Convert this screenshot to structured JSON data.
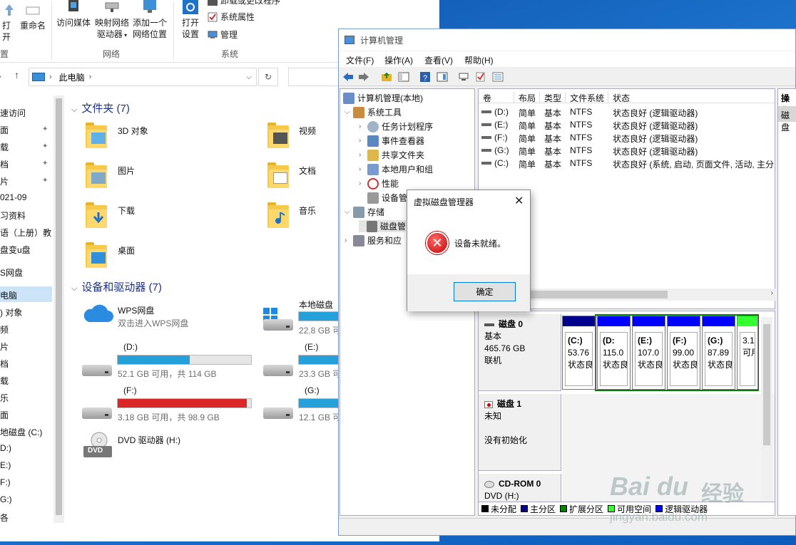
{
  "explorer": {
    "ribbon": {
      "open_partial": "打开",
      "rename": "重命名",
      "left_group_partial": "置",
      "access_media": "访问媒体",
      "map_drive_line1": "映射网络",
      "map_drive_line2": "驱动器",
      "add_location_line1": "添加一个",
      "add_location_line2": "网络位置",
      "group_network": "网络",
      "open_settings_line1": "打开",
      "open_settings_line2": "设置",
      "uninstall_partial": "卸载或更改程序",
      "system_props": "系统属性",
      "manage": "管理",
      "group_system": "系统"
    },
    "address": {
      "path": "此电脑"
    },
    "nav": {
      "items": [
        "速访问",
        "面",
        "载",
        "档",
        "片",
        "021-09",
        "习资料",
        "语（上册）教",
        "盘变u盘",
        "S网盘",
        "电脑",
        ") 对象",
        "频",
        "片",
        "档",
        "载",
        "乐",
        "面",
        "地磁盘 (C:)",
        "D:)",
        "E:)",
        "F:)",
        "G:)",
        "各"
      ]
    },
    "folders_section": {
      "title": "文件夹 (7)"
    },
    "folders": [
      "3D 对象",
      "视频",
      "图片",
      "文档",
      "下载",
      "音乐",
      "桌面"
    ],
    "devices_section": {
      "title": "设备和驱动器 (7)"
    },
    "devices": {
      "wps_name": "WPS网盘",
      "wps_desc": "双击进入WPS网盘",
      "c_name": "本地磁盘",
      "c_free": "22.8 GB 可",
      "d_name": "(D:)",
      "d_free": "52.1 GB 可用，共 114 GB",
      "d_used": 0.54,
      "e_name": "(E:)",
      "e_free": "23.3 GB 可",
      "f_name": "(F:)",
      "f_free": "3.18 GB 可用，共 98.9 GB",
      "f_used": 0.97,
      "g_name": "(G:)",
      "g_free": "12.1 GB 可",
      "dvd_name": "DVD 驱动器 (H:)",
      "dvd_label": "DVD"
    }
  },
  "cm": {
    "title": "计算机管理",
    "menu": [
      "文件(F)",
      "操作(A)",
      "查看(V)",
      "帮助(H)"
    ],
    "tree": {
      "root": "计算机管理(本地)",
      "system_tools": "系统工具",
      "task_scheduler": "任务计划程序",
      "event_viewer": "事件查看器",
      "shared_folders": "共享文件夹",
      "local_users": "本地用户和组",
      "performance": "性能",
      "device_mgr": "设备管",
      "storage": "存储",
      "disk_mgmt": "磁盘管",
      "services": "服务和应"
    },
    "volume_headers": [
      "卷",
      "布局",
      "类型",
      "文件系统",
      "状态"
    ],
    "volumes": [
      {
        "vol": "(D:)",
        "layout": "简单",
        "type": "基本",
        "fs": "NTFS",
        "status": "状态良好 (逻辑驱动器)"
      },
      {
        "vol": "(E:)",
        "layout": "简单",
        "type": "基本",
        "fs": "NTFS",
        "status": "状态良好 (逻辑驱动器)"
      },
      {
        "vol": "(F:)",
        "layout": "简单",
        "type": "基本",
        "fs": "NTFS",
        "status": "状态良好 (逻辑驱动器)"
      },
      {
        "vol": "(G:)",
        "layout": "简单",
        "type": "基本",
        "fs": "NTFS",
        "status": "状态良好 (逻辑驱动器)"
      },
      {
        "vol": "(C:)",
        "layout": "简单",
        "type": "基本",
        "fs": "NTFS",
        "status": "状态良好 (系统, 启动, 页面文件, 活动, 主分"
      }
    ],
    "actions": {
      "header": "操作",
      "sub": "磁盘"
    },
    "disk0": {
      "name": "磁盘 0",
      "type": "基本",
      "size": "465.76 GB",
      "state": "联机"
    },
    "disk0_parts": [
      {
        "label": "(C:)",
        "size": "53.76",
        "status": "状态良"
      },
      {
        "label": "(D:",
        "size": "115.0",
        "status": "状态良"
      },
      {
        "label": "(E:)",
        "size": "107.0",
        "status": "状态良"
      },
      {
        "label": "(F:)",
        "size": "99.00",
        "status": "状态良"
      },
      {
        "label": "(G:)",
        "size": "87.89",
        "status": "状态良"
      },
      {
        "label": "",
        "size": "3.1",
        "status": "可用"
      }
    ],
    "disk1": {
      "name": "磁盘 1",
      "state": "未知",
      "note": "没有初始化"
    },
    "cdrom": {
      "name": "CD-ROM 0",
      "drive": "DVD (H:)"
    },
    "legend": [
      "未分配",
      "主分区",
      "扩展分区",
      "可用空间",
      "逻辑驱动器"
    ],
    "colors": {
      "unalloc": "#000000",
      "primary": "#00008b",
      "extended": "#008000",
      "free": "#33ff33",
      "logical": "#0000ff"
    }
  },
  "dialog": {
    "title": "虚拟磁盘管理器",
    "message": "设备未就绪。",
    "ok": "确定"
  },
  "watermark": {
    "brand": "Bai du",
    "cn": "经验",
    "url": "jingyan.baidu.com"
  }
}
